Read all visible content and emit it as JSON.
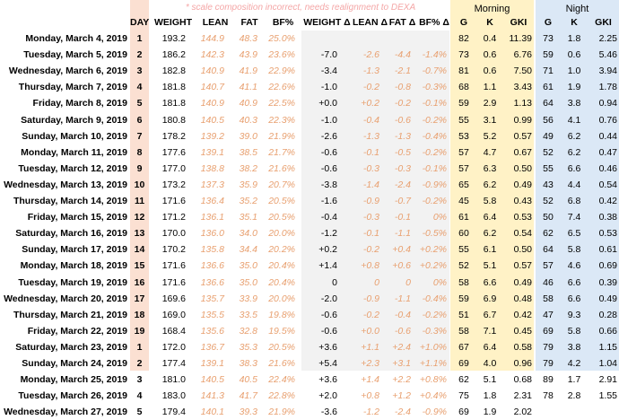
{
  "note": "* scale composition incorrect, needs realignment to DEXA",
  "groups": {
    "morning": "Morning",
    "night": "Night"
  },
  "headers": {
    "day": "DAY",
    "weight": "WEIGHT",
    "lean": "LEAN",
    "fat": "FAT",
    "bf": "BF%",
    "weight_delta": "WEIGHT Δ",
    "lean_delta": "LEAN Δ",
    "fat_delta": "FAT Δ",
    "bf_delta": "BF% Δ",
    "morning_g": "G",
    "morning_k": "K",
    "morning_gki": "GKI",
    "night_g": "G",
    "night_k": "K",
    "night_gki": "GKI"
  },
  "colors": {
    "day_band": "#fbe0d2",
    "morning_band": "#fff2c6",
    "night_band": "#dbe8f6",
    "delta_band": "#f2f2f2",
    "muted_text": "#e8a070",
    "note_text": "#f4a6a6"
  },
  "rows": [
    {
      "date": "Monday, March 4, 2019",
      "day": "1",
      "weight": "193.2",
      "lean": "144.9",
      "fat": "48.3",
      "bf": "25.0%",
      "wd": "",
      "ld": "",
      "fd": "",
      "bd": "",
      "mg": "82",
      "mk": "0.4",
      "mgki": "11.39",
      "ng": "73",
      "nk": "1.8",
      "ngki": "2.25"
    },
    {
      "date": "Tuesday, March 5, 2019",
      "day": "2",
      "weight": "186.2",
      "lean": "142.3",
      "fat": "43.9",
      "bf": "23.6%",
      "wd": "-7.0",
      "ld": "-2.6",
      "fd": "-4.4",
      "bd": "-1.4%",
      "mg": "73",
      "mk": "0.6",
      "mgki": "6.76",
      "ng": "59",
      "nk": "0.6",
      "ngki": "5.46"
    },
    {
      "date": "Wednesday, March 6, 2019",
      "day": "3",
      "weight": "182.8",
      "lean": "140.9",
      "fat": "41.9",
      "bf": "22.9%",
      "wd": "-3.4",
      "ld": "-1.3",
      "fd": "-2.1",
      "bd": "-0.7%",
      "mg": "81",
      "mk": "0.6",
      "mgki": "7.50",
      "ng": "71",
      "nk": "1.0",
      "ngki": "3.94"
    },
    {
      "date": "Thursday, March 7, 2019",
      "day": "4",
      "weight": "181.8",
      "lean": "140.7",
      "fat": "41.1",
      "bf": "22.6%",
      "wd": "-1.0",
      "ld": "-0.2",
      "fd": "-0.8",
      "bd": "-0.3%",
      "mg": "68",
      "mk": "1.1",
      "mgki": "3.43",
      "ng": "61",
      "nk": "1.9",
      "ngki": "1.78"
    },
    {
      "date": "Friday, March 8, 2019",
      "day": "5",
      "weight": "181.8",
      "lean": "140.9",
      "fat": "40.9",
      "bf": "22.5%",
      "wd": "+0.0",
      "ld": "+0.2",
      "fd": "-0.2",
      "bd": "-0.1%",
      "mg": "59",
      "mk": "2.9",
      "mgki": "1.13",
      "ng": "64",
      "nk": "3.8",
      "ngki": "0.94"
    },
    {
      "date": "Saturday, March 9, 2019",
      "day": "6",
      "weight": "180.8",
      "lean": "140.5",
      "fat": "40.3",
      "bf": "22.3%",
      "wd": "-1.0",
      "ld": "-0.4",
      "fd": "-0.6",
      "bd": "-0.2%",
      "mg": "55",
      "mk": "3.1",
      "mgki": "0.99",
      "ng": "56",
      "nk": "4.1",
      "ngki": "0.76"
    },
    {
      "date": "Sunday, March 10, 2019",
      "day": "7",
      "weight": "178.2",
      "lean": "139.2",
      "fat": "39.0",
      "bf": "21.9%",
      "wd": "-2.6",
      "ld": "-1.3",
      "fd": "-1.3",
      "bd": "-0.4%",
      "mg": "53",
      "mk": "5.2",
      "mgki": "0.57",
      "ng": "49",
      "nk": "6.2",
      "ngki": "0.44"
    },
    {
      "date": "Monday, March 11, 2019",
      "day": "8",
      "weight": "177.6",
      "lean": "139.1",
      "fat": "38.5",
      "bf": "21.7%",
      "wd": "-0.6",
      "ld": "-0.1",
      "fd": "-0.5",
      "bd": "-0.2%",
      "mg": "57",
      "mk": "4.7",
      "mgki": "0.67",
      "ng": "52",
      "nk": "6.2",
      "ngki": "0.47"
    },
    {
      "date": "Tuesday, March 12, 2019",
      "day": "9",
      "weight": "177.0",
      "lean": "138.8",
      "fat": "38.2",
      "bf": "21.6%",
      "wd": "-0.6",
      "ld": "-0.3",
      "fd": "-0.3",
      "bd": "-0.1%",
      "mg": "57",
      "mk": "6.3",
      "mgki": "0.50",
      "ng": "55",
      "nk": "6.6",
      "ngki": "0.46"
    },
    {
      "date": "Wednesday, March 13, 2019",
      "day": "10",
      "weight": "173.2",
      "lean": "137.3",
      "fat": "35.9",
      "bf": "20.7%",
      "wd": "-3.8",
      "ld": "-1.4",
      "fd": "-2.4",
      "bd": "-0.9%",
      "mg": "65",
      "mk": "6.2",
      "mgki": "0.49",
      "ng": "43",
      "nk": "4.4",
      "ngki": "0.54"
    },
    {
      "date": "Thursday, March 14, 2019",
      "day": "11",
      "weight": "171.6",
      "lean": "136.4",
      "fat": "35.2",
      "bf": "20.5%",
      "wd": "-1.6",
      "ld": "-0.9",
      "fd": "-0.7",
      "bd": "-0.2%",
      "mg": "45",
      "mk": "5.8",
      "mgki": "0.43",
      "ng": "52",
      "nk": "6.8",
      "ngki": "0.42"
    },
    {
      "date": "Friday, March 15, 2019",
      "day": "12",
      "weight": "171.2",
      "lean": "136.1",
      "fat": "35.1",
      "bf": "20.5%",
      "wd": "-0.4",
      "ld": "-0.3",
      "fd": "-0.1",
      "bd": "0%",
      "mg": "61",
      "mk": "6.4",
      "mgki": "0.53",
      "ng": "50",
      "nk": "7.4",
      "ngki": "0.38"
    },
    {
      "date": "Saturday, March 16, 2019",
      "day": "13",
      "weight": "170.0",
      "lean": "136.0",
      "fat": "34.0",
      "bf": "20.0%",
      "wd": "-1.2",
      "ld": "-0.1",
      "fd": "-1.1",
      "bd": "-0.5%",
      "mg": "60",
      "mk": "6.2",
      "mgki": "0.54",
      "ng": "62",
      "nk": "6.5",
      "ngki": "0.53"
    },
    {
      "date": "Sunday, March 17, 2019",
      "day": "14",
      "weight": "170.2",
      "lean": "135.8",
      "fat": "34.4",
      "bf": "20.2%",
      "wd": "+0.2",
      "ld": "-0.2",
      "fd": "+0.4",
      "bd": "+0.2%",
      "mg": "55",
      "mk": "6.1",
      "mgki": "0.50",
      "ng": "64",
      "nk": "5.8",
      "ngki": "0.61"
    },
    {
      "date": "Monday, March 18, 2019",
      "day": "15",
      "weight": "171.6",
      "lean": "136.6",
      "fat": "35.0",
      "bf": "20.4%",
      "wd": "+1.4",
      "ld": "+0.8",
      "fd": "+0.6",
      "bd": "+0.2%",
      "mg": "52",
      "mk": "5.1",
      "mgki": "0.57",
      "ng": "57",
      "nk": "4.6",
      "ngki": "0.69"
    },
    {
      "date": "Tuesday, March 19, 2019",
      "day": "16",
      "weight": "171.6",
      "lean": "136.6",
      "fat": "35.0",
      "bf": "20.4%",
      "wd": "0",
      "ld": "0",
      "fd": "0",
      "bd": "0%",
      "mg": "58",
      "mk": "6.6",
      "mgki": "0.49",
      "ng": "46",
      "nk": "6.6",
      "ngki": "0.39"
    },
    {
      "date": "Wednesday, March 20, 2019",
      "day": "17",
      "weight": "169.6",
      "lean": "135.7",
      "fat": "33.9",
      "bf": "20.0%",
      "wd": "-2.0",
      "ld": "-0.9",
      "fd": "-1.1",
      "bd": "-0.4%",
      "mg": "59",
      "mk": "6.9",
      "mgki": "0.48",
      "ng": "58",
      "nk": "6.6",
      "ngki": "0.49"
    },
    {
      "date": "Thursday, March 21, 2019",
      "day": "18",
      "weight": "169.0",
      "lean": "135.5",
      "fat": "33.5",
      "bf": "19.8%",
      "wd": "-0.6",
      "ld": "-0.2",
      "fd": "-0.4",
      "bd": "-0.2%",
      "mg": "51",
      "mk": "6.7",
      "mgki": "0.42",
      "ng": "47",
      "nk": "9.3",
      "ngki": "0.28"
    },
    {
      "date": "Friday, March 22, 2019",
      "day": "19",
      "weight": "168.4",
      "lean": "135.6",
      "fat": "32.8",
      "bf": "19.5%",
      "wd": "-0.6",
      "ld": "+0.0",
      "fd": "-0.6",
      "bd": "-0.3%",
      "mg": "58",
      "mk": "7.1",
      "mgki": "0.45",
      "ng": "69",
      "nk": "5.8",
      "ngki": "0.66"
    },
    {
      "date": "Saturday, March 23, 2019",
      "day": "1",
      "weight": "172.0",
      "lean": "136.7",
      "fat": "35.3",
      "bf": "20.5%",
      "wd": "+3.6",
      "ld": "+1.1",
      "fd": "+2.4",
      "bd": "+1.0%",
      "mg": "67",
      "mk": "6.4",
      "mgki": "0.58",
      "ng": "79",
      "nk": "3.8",
      "ngki": "1.15"
    },
    {
      "date": "Sunday, March 24, 2019",
      "day": "2",
      "weight": "177.4",
      "lean": "139.1",
      "fat": "38.3",
      "bf": "21.6%",
      "wd": "+5.4",
      "ld": "+2.3",
      "fd": "+3.1",
      "bd": "+1.1%",
      "mg": "69",
      "mk": "4.0",
      "mgki": "0.96",
      "ng": "79",
      "nk": "4.2",
      "ngki": "1.04"
    },
    {
      "date": "Monday, March 25, 2019",
      "day": "3",
      "weight": "181.0",
      "lean": "140.5",
      "fat": "40.5",
      "bf": "22.4%",
      "wd": "+3.6",
      "ld": "+1.4",
      "fd": "+2.2",
      "bd": "+0.8%",
      "mg": "62",
      "mk": "5.1",
      "mgki": "0.68",
      "ng": "89",
      "nk": "1.7",
      "ngki": "2.91"
    },
    {
      "date": "Tuesday, March 26, 2019",
      "day": "4",
      "weight": "183.0",
      "lean": "141.3",
      "fat": "41.7",
      "bf": "22.8%",
      "wd": "+2.0",
      "ld": "+0.8",
      "fd": "+1.2",
      "bd": "+0.4%",
      "mg": "75",
      "mk": "1.8",
      "mgki": "2.31",
      "ng": "78",
      "nk": "2.8",
      "ngki": "1.55"
    },
    {
      "date": "Wednesday, March 27, 2019",
      "day": "5",
      "weight": "179.4",
      "lean": "140.1",
      "fat": "39.3",
      "bf": "21.9%",
      "wd": "-3.6",
      "ld": "-1.2",
      "fd": "-2.4",
      "bd": "-0.9%",
      "mg": "69",
      "mk": "1.9",
      "mgki": "2.02",
      "ng": "",
      "nk": "",
      "ngki": ""
    }
  ]
}
